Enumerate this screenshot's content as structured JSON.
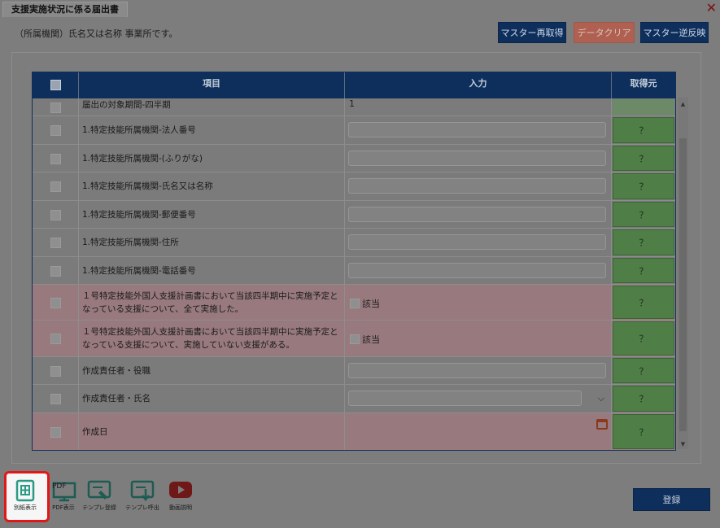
{
  "window": {
    "title": "支援実施状況に係る届出書",
    "close": "✕",
    "subtitle": "（所属機関）氏名又は名称 事業所です。"
  },
  "buttons": {
    "master_refetch": "マスター再取得",
    "data_clear": "データクリア",
    "master_reverse": "マスター逆反映"
  },
  "grid": {
    "headers": {
      "item": "項目",
      "input": "入力",
      "source": "取得元"
    },
    "source_label": "？",
    "rows": [
      {
        "label": "届出の対象期間-四半期",
        "value": "1"
      },
      {
        "label": "1.特定技能所属機関-法人番号"
      },
      {
        "label": "1.特定技能所属機関-(ふりがな)"
      },
      {
        "label": "1.特定技能所属機関-氏名又は名称"
      },
      {
        "label": "1.特定技能所属機関-郵便番号"
      },
      {
        "label": "1.特定技能所属機関-住所"
      },
      {
        "label": "1.特定技能所属機関-電話番号"
      },
      {
        "label": "１号特定技能外国人支援計画書において当該四半期中に実施予定となっている支援について、全て実施した。",
        "check_label": "該当"
      },
      {
        "label": "１号特定技能外国人支援計画書において当該四半期中に実施予定となっている支援について、実施していない支援がある。",
        "check_label": "該当"
      },
      {
        "label": "作成責任者・役職"
      },
      {
        "label": "作成責任者・氏名"
      },
      {
        "label": "作成日"
      }
    ]
  },
  "toolbar": {
    "items": [
      {
        "label": "別紙表示",
        "icon": "sheet-icon"
      },
      {
        "label": "PDF表示",
        "icon": "pdf-icon",
        "icon_text": "PDF"
      },
      {
        "label": "テンプレ登録",
        "icon": "template-register-icon"
      },
      {
        "label": "テンプレ呼出",
        "icon": "template-call-icon"
      },
      {
        "label": "動画説明",
        "icon": "video-icon"
      }
    ],
    "register": "登録"
  },
  "colors": {
    "header_navy": "#0e2f5c",
    "clear_button": "#b06050",
    "source_green": "#4f7e47",
    "pink_row": "#987a7e",
    "focus_red": "#e01818"
  }
}
